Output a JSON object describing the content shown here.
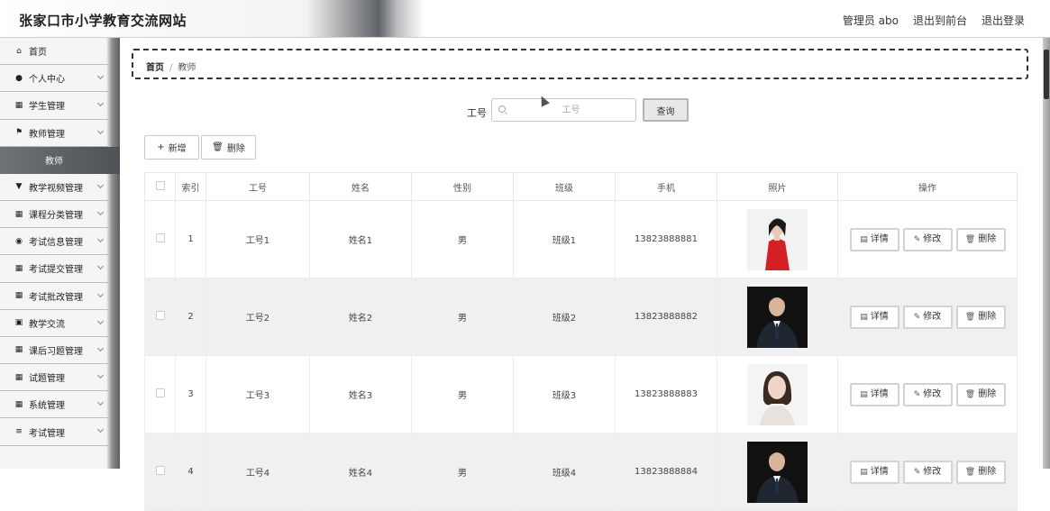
{
  "header": {
    "site_title": "张家口市小学教育交流网站",
    "links": [
      "管理员 abo",
      "退出到前台",
      "退出登录"
    ]
  },
  "sidebar": {
    "items": [
      {
        "label": "首页",
        "icon": "home-icon",
        "glyph": "⌂",
        "expandable": false
      },
      {
        "label": "个人中心",
        "icon": "user-icon",
        "glyph": "●",
        "expandable": true
      },
      {
        "label": "学生管理",
        "icon": "grid-icon",
        "glyph": "▦",
        "expandable": true
      },
      {
        "label": "教师管理",
        "icon": "flag-icon",
        "glyph": "⚑",
        "expandable": true
      },
      {
        "label": "教学视频管理",
        "icon": "funnel-icon",
        "glyph": "▼",
        "expandable": true
      },
      {
        "label": "课程分类管理",
        "icon": "grid-icon",
        "glyph": "▦",
        "expandable": true
      },
      {
        "label": "考试信息管理",
        "icon": "map-pin-icon",
        "glyph": "◉",
        "expandable": true
      },
      {
        "label": "考试提交管理",
        "icon": "grid-icon",
        "glyph": "▦",
        "expandable": true
      },
      {
        "label": "考试批改管理",
        "icon": "grid-icon",
        "glyph": "▦",
        "expandable": true
      },
      {
        "label": "教学交流",
        "icon": "chart-icon",
        "glyph": "▣",
        "expandable": true
      },
      {
        "label": "课后习题管理",
        "icon": "grid-icon",
        "glyph": "▦",
        "expandable": true
      },
      {
        "label": "试题管理",
        "icon": "grid-icon",
        "glyph": "▦",
        "expandable": true
      },
      {
        "label": "系统管理",
        "icon": "grid-icon",
        "glyph": "▦",
        "expandable": true
      },
      {
        "label": "考试管理",
        "icon": "list-icon",
        "glyph": "≡",
        "expandable": true
      }
    ],
    "active_sub": "教师"
  },
  "breadcrumb": {
    "home": "首页",
    "separator": "/",
    "current": "教师"
  },
  "search": {
    "label": "工号",
    "placeholder": "工号",
    "value": "",
    "button": "查询"
  },
  "actions": {
    "add": "新增",
    "delete": "删除"
  },
  "table": {
    "columns": [
      "索引",
      "工号",
      "姓名",
      "性别",
      "班级",
      "手机",
      "照片",
      "操作"
    ],
    "rows": [
      {
        "index": "1",
        "job_no": "工号1",
        "name": "姓名1",
        "gender": "男",
        "class": "班级1",
        "phone": "13823888881",
        "photo_desc": "woman-red-dress"
      },
      {
        "index": "2",
        "job_no": "工号2",
        "name": "姓名2",
        "gender": "男",
        "class": "班级2",
        "phone": "13823888882",
        "photo_desc": "man-suit"
      },
      {
        "index": "3",
        "job_no": "工号3",
        "name": "姓名3",
        "gender": "男",
        "class": "班级3",
        "phone": "13823888883",
        "photo_desc": "woman-portrait"
      },
      {
        "index": "4",
        "job_no": "工号4",
        "name": "姓名4",
        "gender": "男",
        "class": "班级4",
        "phone": "13823888884",
        "photo_desc": "man-suit"
      }
    ],
    "row_actions": {
      "detail": "详情",
      "edit": "修改",
      "delete": "删除"
    }
  },
  "colors": {
    "accent_dark": "#5a5d61",
    "row_alt": "#eff0f2",
    "border": "#e6e6e6"
  }
}
